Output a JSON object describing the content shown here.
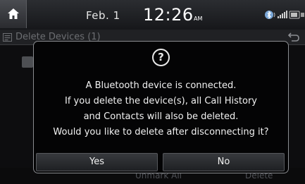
{
  "status_bar": {
    "date": "Feb.  1",
    "time": "12:26",
    "ampm": "AM"
  },
  "header": {
    "title": "Delete Devices (1)"
  },
  "background_buttons": {
    "left_label": "Unmark All",
    "right_label": "Delete"
  },
  "dialog": {
    "icon": "question-icon",
    "lines": [
      "A Bluetooth device is connected.",
      "If you delete the device(s), all Call History",
      "and Contacts will also be deleted.",
      "Would you like to delete after disconnecting it?"
    ],
    "yes_label": "Yes",
    "no_label": "No"
  },
  "icons": {
    "home": "home-icon",
    "bluetooth": "bluetooth-icon",
    "signal": "signal-icon",
    "title": "list-icon",
    "back": "back-icon"
  },
  "colors": {
    "dialog_border": "#8a8c90",
    "dialog_background": "#040405",
    "text": "#f2f2f2",
    "dimmed_text": "#6c6e72"
  }
}
